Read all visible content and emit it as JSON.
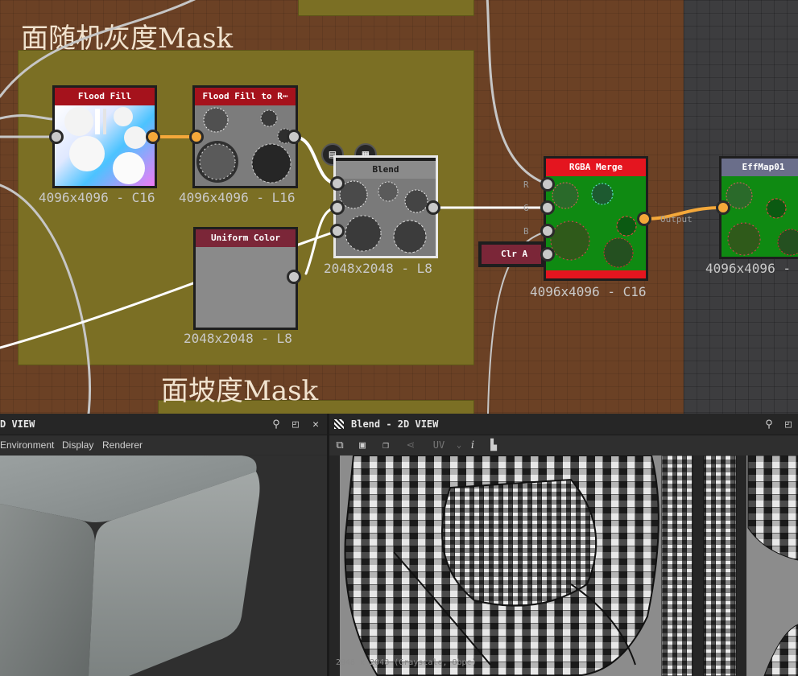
{
  "frames": {
    "random_gray": {
      "title": "面随机灰度Mask"
    },
    "slope": {
      "title": "面坡度Mask"
    }
  },
  "nodes": {
    "flood_fill": {
      "title": "Flood Fill",
      "size": "4096x4096 - C16"
    },
    "flood_fill_to_r": {
      "title": "Flood Fill to R⋯",
      "size": "4096x4096 - L16"
    },
    "uniform_color": {
      "title": "Uniform Color",
      "size": "2048x2048 - L8"
    },
    "blend": {
      "title": "Blend",
      "size": "2048x2048 - L8"
    },
    "rgba_merge": {
      "title": "RGBA Merge",
      "size": "4096x4096 - C16",
      "ports": {
        "r": "R",
        "g": "G",
        "b": "B"
      },
      "output_label": "Output"
    },
    "clr_a": {
      "title": "Clr A"
    },
    "effmap": {
      "title": "EffMap01",
      "size": "4096x4096 -"
    }
  },
  "panels": {
    "view3d": {
      "title": "D VIEW",
      "menu": [
        "Environment",
        "Display",
        "Renderer"
      ]
    },
    "view2d": {
      "title": "Blend - 2D VIEW",
      "uv_label": "UV",
      "footer": "2048 x 2048 (Grayscale, 8bpc)"
    }
  },
  "colors": {
    "graph_bg": "#6b4125",
    "frame_bg": "#7b6f24",
    "orange_wire": "#f4a83a",
    "red_title": "#a5121c",
    "maroon_title": "#7b2638",
    "merge_green": "#0f8a12"
  }
}
